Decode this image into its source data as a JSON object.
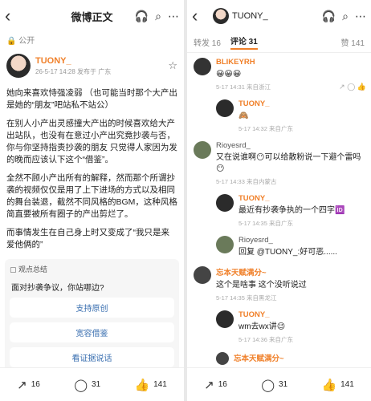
{
  "left": {
    "title": "微博正文",
    "public": "公开",
    "author": {
      "name": "TUONY_",
      "meta": "26-5-17 14:28 发布于 广东"
    },
    "paragraphs": [
      "她向来喜欢恃强凌弱 （也可能当时那个大产出是她的“朋友”吧站私不站公）",
      "在别人小产出灵感撞大产出的时候喜欢给大产出站队，也没有在意过小产出究竟抄袭与否，你与你坚持指责抄袭的朋友 只觉得人家因为发的晚而应该认下这个“借鉴”。",
      "全然不顾小产出所有的解释，然而那个所谓抄袭的视频仅仅是用了上下进场的方式以及相同的舞台装退，截然不同风格的BGM，这种风格简直要被所有圈子的产出剪烂了。",
      "而事情发生在自己身上时又变成了“我只是来爱他俩的”"
    ],
    "summary": {
      "header": "观点总结",
      "question": "面对抄袭争议，你站哪边?",
      "options": [
        "支持原创",
        "宽容借鉴",
        "看证据说话"
      ]
    },
    "bottom": {
      "share": "16",
      "comment": "31",
      "like": "141"
    }
  },
  "right": {
    "author": "TUONY_",
    "tabs": {
      "repost": "转发 16",
      "comment": "评论 31",
      "like": "赞 141"
    },
    "comments": [
      {
        "name": "BLIKEYRH",
        "text": "😀😀😀",
        "meta": "5-17 14:31 来自浙江"
      },
      {
        "name": "TUONY_",
        "text": "🙈",
        "meta": "5-17 14:32 来自广东"
      },
      {
        "name": "Rioyesrd_",
        "text": "又在说谁啊😶可以给散粉说一下避个雷吗😶",
        "meta": "5-17 14:33 来自内蒙古"
      },
      {
        "name": "TUONY_",
        "text": "最近有抄袭争执的一个四字🆔",
        "meta": "5-17 14:35 来自广东"
      },
      {
        "name": "Rioyesrd_",
        "text": "回复 @TUONY_:好可恶......",
        "meta": ""
      },
      {
        "name": "忘本天赋满分~",
        "text": "这个是啥事 这个没听说过",
        "meta": "5-17 14:35 来自黑龙江"
      },
      {
        "name": "TUONY_",
        "text": "wm去wx讲😉",
        "meta": "5-17 14:36 来自广东"
      },
      {
        "name": "忘本天赋满分~",
        "text": "",
        "meta": ""
      }
    ],
    "bottom": {
      "share": "16",
      "comment": "31",
      "like": "141"
    }
  }
}
